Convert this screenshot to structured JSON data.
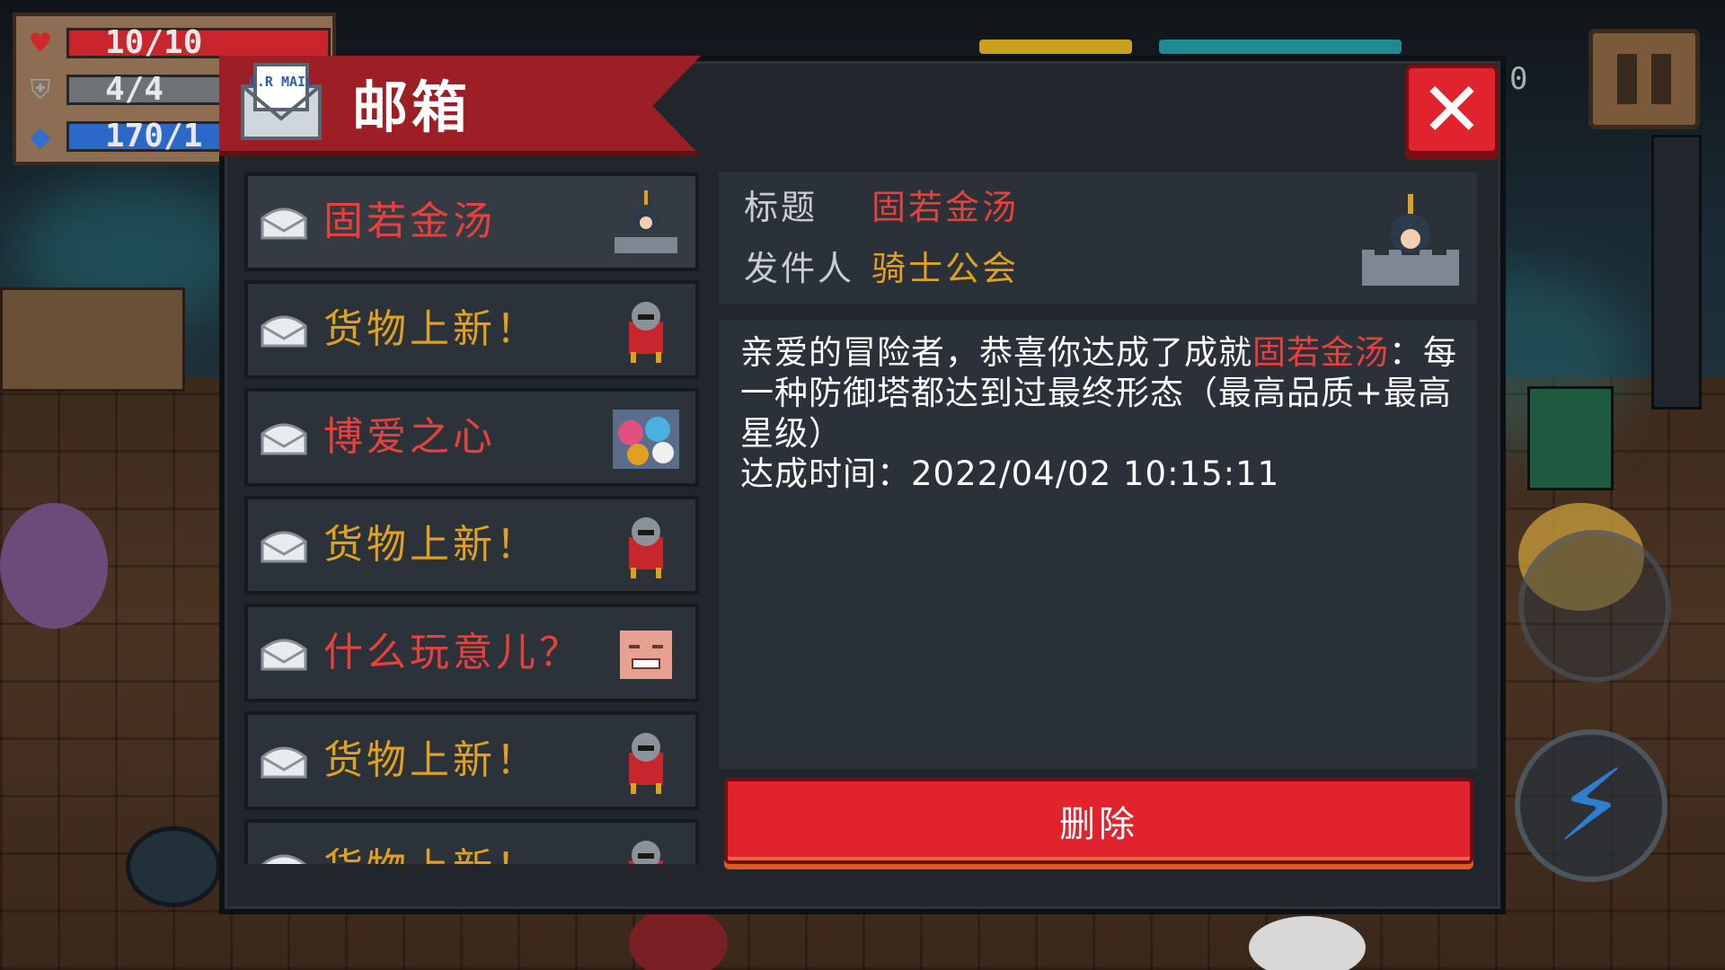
{
  "hud": {
    "health": "10/10",
    "armor": "4/4",
    "energy": "170/1",
    "counter": "0"
  },
  "mailbox": {
    "title": "邮箱",
    "mail_icon_text": "C.R MAIL",
    "close_label": "✕",
    "items": [
      {
        "title": "固若金汤",
        "color": "red",
        "thumb": "knight-tower-icon"
      },
      {
        "title": "货物上新！",
        "color": "gold",
        "thumb": "merchant-icon"
      },
      {
        "title": "博爱之心",
        "color": "red",
        "thumb": "pets-icon"
      },
      {
        "title": "货物上新！",
        "color": "gold",
        "thumb": "merchant-icon"
      },
      {
        "title": "什么玩意儿？",
        "color": "red",
        "thumb": "face-icon"
      },
      {
        "title": "货物上新！",
        "color": "gold",
        "thumb": "merchant-icon"
      },
      {
        "title": "货物上新！",
        "color": "gold",
        "thumb": "merchant-icon"
      }
    ],
    "detail": {
      "subject_label": "标题",
      "subject_value": "固若金汤",
      "sender_label": "发件人",
      "sender_value": "骑士公会",
      "body_prefix": "亲爱的冒险者，恭喜你达成了成就",
      "body_highlight": "固若金汤",
      "body_suffix": "：每一种防御塔都达到过最终形态（最高品质+最高星级）",
      "time_line": "达成时间：2022/04/02 10:15:11"
    },
    "delete_label": "删除"
  },
  "colors": {
    "accent_red": "#e0232c",
    "title_red": "#e8403c",
    "title_gold": "#e0a020",
    "panel": "#21262c"
  }
}
